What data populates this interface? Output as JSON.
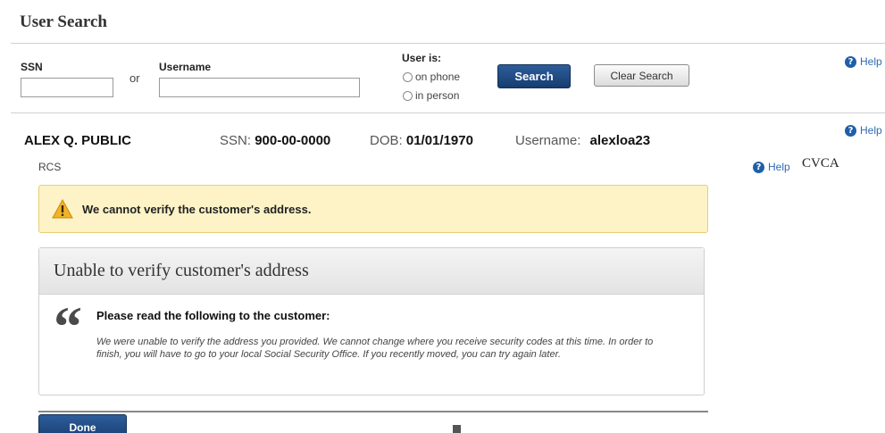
{
  "page_title": "User Search",
  "search": {
    "ssn_label": "SSN",
    "ssn_value": "",
    "or_text": "or",
    "username_label": "Username",
    "username_value": "",
    "user_is_label": "User is:",
    "radio_options": [
      "on phone",
      "in person"
    ],
    "search_button": "Search",
    "clear_button": "Clear Search",
    "help_label": "Help"
  },
  "customer": {
    "name": "ALEX Q. PUBLIC",
    "ssn_label": "SSN:",
    "ssn": "900-00-0000",
    "dob_label": "DOB:",
    "dob": "01/01/1970",
    "username_label": "Username:",
    "username": "alexloa23",
    "help_label": "Help",
    "rcs": "RCS",
    "cvca_help_label": "Help",
    "cvca": "CVCA"
  },
  "alert": {
    "message": "We cannot verify the customer's address."
  },
  "panel": {
    "title": "Unable to verify customer's address",
    "quote_mark": "“",
    "read_heading": "Please read the following to the customer:",
    "script": "We were unable to verify the address you provided. We cannot change where you receive security codes at this time. In order to finish, you will have to go to your local Social Security Office. If you recently moved, you can try again later."
  },
  "footer": {
    "done_button": "Done"
  },
  "colors": {
    "primary_button": "#1f4a82",
    "alert_background": "#fdf3c6",
    "alert_border": "#e6cf72",
    "help_icon": "#1f5fa8"
  }
}
